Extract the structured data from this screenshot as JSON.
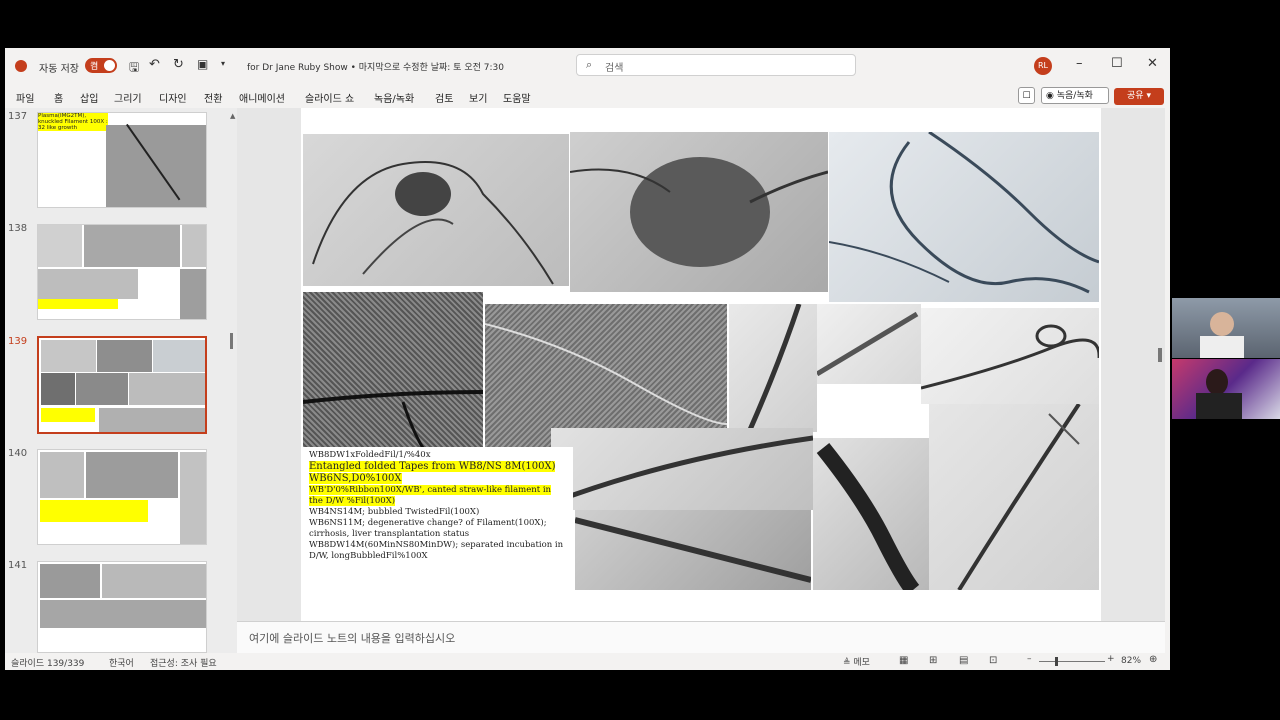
{
  "app": {
    "autosave_label": "자동 저장",
    "autosave_state": "켬",
    "doc_title": "for Dr Jane Ruby Show • 마지막으로 수정한 날짜: 토 오전 7:30",
    "search_placeholder": "검색",
    "user_initials": "RL"
  },
  "ribbon": {
    "tabs": [
      "파일",
      "홈",
      "삽입",
      "그리기",
      "디자인",
      "전환",
      "애니메이션",
      "슬라이드 쇼",
      "녹음/녹화",
      "검토",
      "보기",
      "도움말"
    ],
    "record_label": "녹음/녹화",
    "share_label": "공유"
  },
  "thumbnails": [
    {
      "number": "137",
      "caption": "Plasma(IMG2TM), knuckled Filament 100X : 32 like growth"
    },
    {
      "number": "138",
      "caption": ""
    },
    {
      "number": "139",
      "caption": ""
    },
    {
      "number": "140",
      "caption": ""
    },
    {
      "number": "141",
      "caption": ""
    }
  ],
  "slide": {
    "text_lines": [
      {
        "text": "WB8DW1xFoldedFil/1/%40x",
        "style": "normal"
      },
      {
        "text": "Entangled folded Tapes from WB8/NS 8M(100X)",
        "style": "big"
      },
      {
        "text": "WB6NS,D0%100X",
        "style": "big"
      },
      {
        "text": "WB'D'0%Ribbon100X/WB', canted straw-like filament in the D/W %Fil(100X)",
        "style": "hl"
      },
      {
        "text": "WB4NS14M; bubbled TwistedFil(100X)",
        "style": "normal"
      },
      {
        "text": "WB6NS11M; degenerative change? of Filament(100X); cirrhosis, liver transplantation status",
        "style": "normal"
      },
      {
        "text": "WB8DW14M(60MinNS80MinDW); separated incubation in D/W, longBubbledFil%100X",
        "style": "normal"
      }
    ]
  },
  "notes": {
    "placeholder": "여기에 슬라이드 노트의 내용을 입력하십시오"
  },
  "status": {
    "slide_counter": "슬라이드 139/339",
    "language": "한국어",
    "accessibility": "접근성: 조사 필요",
    "notes_label": "메모",
    "zoom": "82%"
  },
  "colors": {
    "accent": "#c43e1c",
    "highlight": "#ffff00"
  }
}
